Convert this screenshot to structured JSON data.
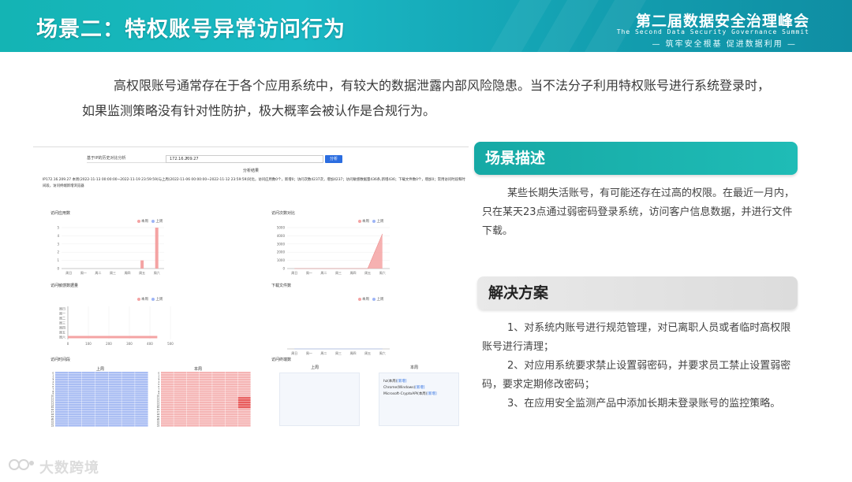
{
  "header": {
    "title": "场景二：特权账号异常访问行为",
    "summit_cn": "第二届数据安全治理峰会",
    "summit_en": "The Second Data Security Governance Summit",
    "summit_slogan": "— 筑牢安全根基  促进数据利用 —"
  },
  "intro": "高权限账号通常存在于各个应用系统中，有较大的数据泄露内部风险隐患。当不法分子利用特权账号进行系统登录时，如果监测策略没有针对性防护，极大概率会被认作是合规行为。",
  "screenshot": {
    "select_label": "基于IP的历史对比分析",
    "input_value": "172.16.209.27",
    "button_label": "分析",
    "result_title": "分析结果",
    "summary_text": "IP172.16.209.27 本周(2022-11-13 00:00:00~2022-11-19 23:59:59)与上周(2022-11-06 00:00:00~2022-11-12 23:59:59)对比，访问应用数0个，新增0；访问次数4237次，增加4237；访问敏感数据量436条,新增436；下载文件数0个，增加0；常用访问时段和时间段，访问终端新增浏览器",
    "legend_this_week": "本周",
    "legend_last_week": "上周",
    "charts": {
      "app_count": {
        "title": "访问应用数",
        "yticks": [
          "0",
          "1",
          "2",
          "3",
          "4",
          "5"
        ],
        "xticks": [
          "周日",
          "周一",
          "周二",
          "周三",
          "周四",
          "周五",
          "周六"
        ]
      },
      "visit_count": {
        "title": "访问次数对比",
        "yticks": [
          "0",
          "1000",
          "2000",
          "3000",
          "4000",
          "5000"
        ],
        "xticks": [
          "周日",
          "周一",
          "周二",
          "周三",
          "周四",
          "周五",
          "周六"
        ]
      },
      "sensitive": {
        "title": "访问敏感数据量",
        "yticks": [
          "周日",
          "周一",
          "周二",
          "周三",
          "周四",
          "周五",
          "周六"
        ],
        "xticks": [
          "0",
          "100",
          "200",
          "300",
          "400",
          "500"
        ]
      },
      "download": {
        "title": "下载文件数",
        "xticks": [
          "周日",
          "周一",
          "周二",
          "周三",
          "周四",
          "周五",
          "周六"
        ]
      }
    },
    "heat": {
      "title": "访问时间段",
      "last_week": "上周",
      "this_week": "本周"
    },
    "browser": {
      "title": "访问终端数",
      "last_week": "上周",
      "this_week": "本周",
      "item1": "hz(本周)",
      "item1_link": "[新增]",
      "item2": "Chrome(Windows)",
      "item2_link": "[新增]",
      "item3": "Microsoft-CryptoAPI(本周)",
      "item3_link": "[新增]"
    }
  },
  "scene": {
    "heading": "场景描述",
    "body": "某些长期失活账号，有可能还存在过高的权限。在最近一月内，只在某天23点通过弱密码登录系统，访问客户信息数据，并进行文件下载。"
  },
  "solution": {
    "heading": "解决方案",
    "items": [
      "1、对系统内账号进行规范管理，对已离职人员或者临时高权限账号进行清理；",
      "2、对应用系统要求禁止设置弱密码，并要求员工禁止设置弱密码，要求定期修改密码；",
      "3、在应用安全监测产品中添加长期未登录账号的监控策略。"
    ]
  },
  "watermark": "大数跨境",
  "colors": {
    "teal": "#16a9a5",
    "this_week": "#f4a3a3",
    "last_week": "#9db4f5"
  },
  "chart_data": [
    {
      "type": "bar",
      "title": "访问应用数",
      "categories": [
        "周日",
        "周一",
        "周二",
        "周三",
        "周四",
        "周五",
        "周六"
      ],
      "ylim": [
        0,
        5
      ],
      "series": [
        {
          "name": "本周",
          "values": [
            0,
            0,
            0,
            0,
            0,
            1,
            5
          ]
        },
        {
          "name": "上周",
          "values": [
            0,
            0,
            0,
            0,
            0,
            0,
            0
          ]
        }
      ]
    },
    {
      "type": "area",
      "title": "访问次数对比",
      "categories": [
        "周日",
        "周一",
        "周二",
        "周三",
        "周四",
        "周五",
        "周六"
      ],
      "ylim": [
        0,
        5000
      ],
      "series": [
        {
          "name": "本周",
          "values": [
            0,
            0,
            0,
            0,
            0,
            0,
            4237
          ]
        },
        {
          "name": "上周",
          "values": [
            0,
            0,
            0,
            0,
            0,
            0,
            0
          ]
        }
      ]
    },
    {
      "type": "bar",
      "title": "访问敏感数据量",
      "categories": [
        "周日",
        "周一",
        "周二",
        "周三",
        "周四",
        "周五",
        "周六"
      ],
      "xlim": [
        0,
        500
      ],
      "orientation": "horizontal",
      "series": [
        {
          "name": "本周",
          "values": [
            0,
            0,
            0,
            0,
            0,
            0,
            436
          ]
        },
        {
          "name": "上周",
          "values": [
            0,
            0,
            0,
            0,
            0,
            0,
            0
          ]
        }
      ]
    },
    {
      "type": "line",
      "title": "下载文件数",
      "categories": [
        "周日",
        "周一",
        "周二",
        "周三",
        "周四",
        "周五",
        "周六"
      ],
      "series": [
        {
          "name": "本周",
          "values": [
            0,
            0,
            0,
            0,
            0,
            0,
            0
          ]
        },
        {
          "name": "上周",
          "values": [
            0,
            0,
            0,
            0,
            0,
            0,
            0
          ]
        }
      ]
    }
  ]
}
